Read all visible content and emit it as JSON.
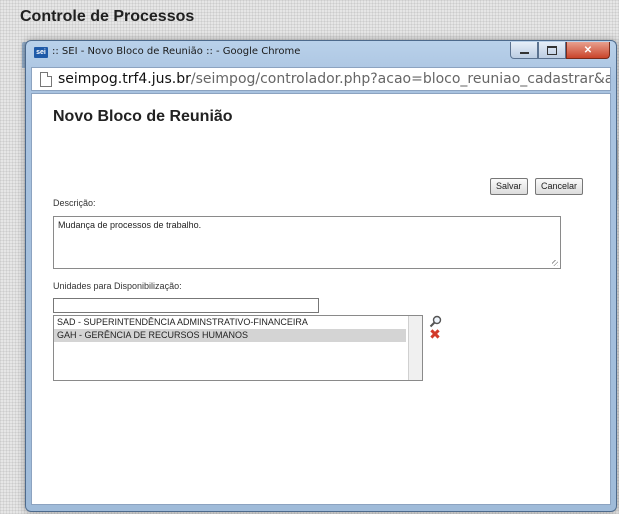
{
  "page": {
    "title": "Controle de Processos"
  },
  "window": {
    "title": ":: SEI - Novo Bloco de Reunião :: - Google Chrome",
    "icon_label": "sei"
  },
  "address_bar": {
    "host": "seimpog.trf4.jus.br",
    "path": "/seimpog/controlador.php?acao=bloco_reuniao_cadastrar&acao_origem=bloc"
  },
  "form": {
    "title": "Novo Bloco de Reunião",
    "save_label": "Salvar",
    "cancel_label": "Cancelar",
    "description_label": "Descrição:",
    "description_value": "Mudança de processos de trabalho.",
    "units_label": "Unidades para Disponibilização:",
    "unit_input_value": "",
    "units": [
      {
        "label": "SAD - SUPERINTENDÊNCIA ADMINSTRATIVO-FINANCEIRA",
        "selected": false
      },
      {
        "label": "GAH - GERÊNCIA DE RECURSOS HUMANOS",
        "selected": true
      }
    ]
  },
  "icons": {
    "search": "search-icon",
    "remove": "remove-icon"
  },
  "colors": {
    "remove_icon": "#d23a2a",
    "selection": "#d4d4d4",
    "window_frame": "#a9c3e0"
  }
}
